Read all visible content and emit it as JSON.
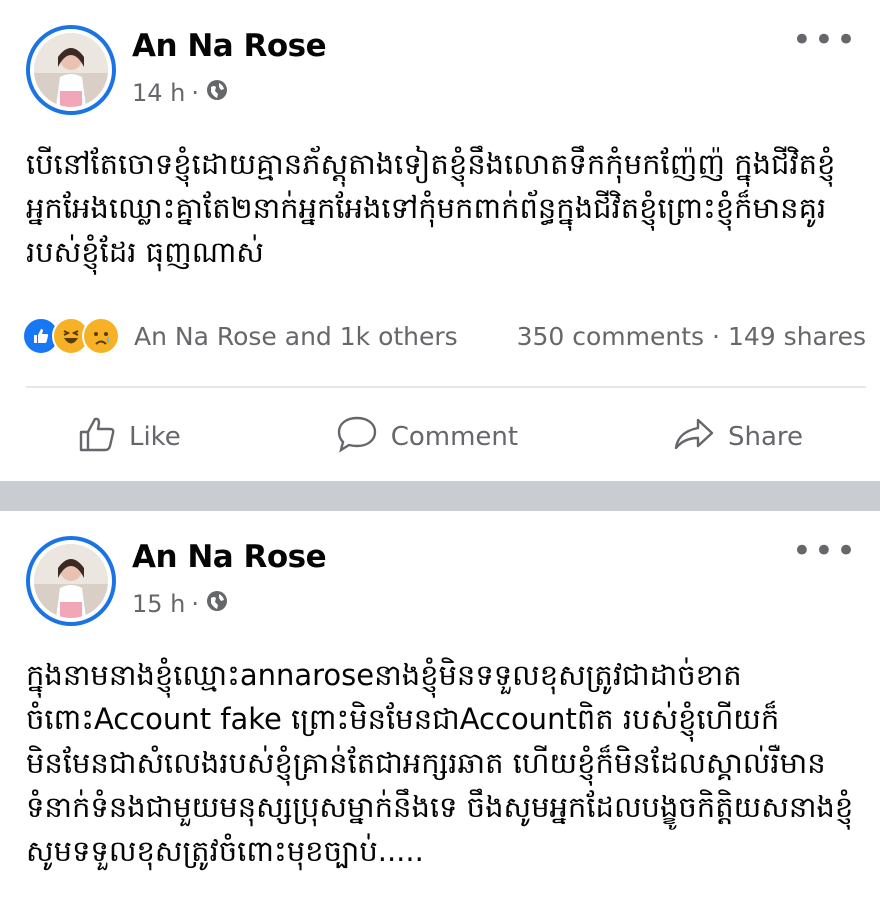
{
  "posts": [
    {
      "author": "An Na Rose",
      "time": "14 h",
      "text": "បើនៅតែចោទខ្ញុំដោយគ្មានភ័ស្តុតាងទៀតខ្ញុំនឹងលោតទឹកកុំមកញ៉ែញ៉ ក្នុងជីវិតខ្ញុំ អ្នកអែងឈ្លោះគ្នាតែ២នាក់អ្នកអែងទៅកុំមកពាក់ព័ន្ធក្នុងជីវិតខ្ញុំព្រោះខ្ញុំក៏មានគូររបស់ខ្ញុំដែរ ធុញណាស់",
      "reactions_text": "An Na Rose  and 1k others",
      "comments_text": "350 comments",
      "shares_text": "149 shares",
      "actions": {
        "like": "Like",
        "comment": "Comment",
        "share": "Share"
      }
    },
    {
      "author": "An Na Rose",
      "time": "15 h",
      "text": "ក្នុងនាមនាងខ្ញុំឈ្មោះannaroseនាងខ្ញុំមិនទទួលខុសត្រូវជាដាច់ខាតចំពោះAccount fake ព្រោះមិនមែនជាAccountពិត របស់ខ្ញុំហើយក៏មិនមែនជាសំលេងរបស់ខ្ញុំគ្រាន់តែជាអក្សរឆាត ហើយខ្ញុំក៏មិនដែលស្គាល់រឺមានទំនាក់ទំនងជាមួយមនុស្សប្រុសម្នាក់នឹងទេ ចឹងសូមអ្នកដែលបង្ខូចកិត្តិយសនាងខ្ញុំសូមទទួលខុសត្រូវចំពោះមុខច្បាប់....."
    }
  ],
  "colors": {
    "accent": "#1877f2",
    "muted": "#65676b",
    "divider": "#c9ccd1"
  },
  "icons": [
    "globe-icon",
    "more-icon",
    "like-reaction-icon",
    "haha-reaction-icon",
    "sad-reaction-icon",
    "thumbs-up-icon",
    "comment-icon",
    "share-icon"
  ]
}
